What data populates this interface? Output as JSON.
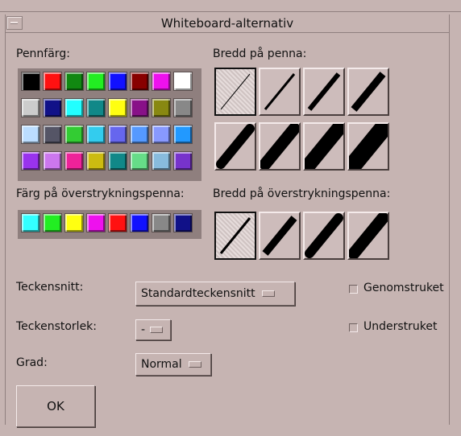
{
  "window": {
    "title": "Whiteboard-alternativ"
  },
  "pen_color": {
    "label": "Pennfärg:",
    "colors": [
      "#000000",
      "#ff1111",
      "#118811",
      "#22ee22",
      "#1111ff",
      "#880000",
      "#ee11ee",
      "#ffffff",
      "#cccccc",
      "#111188",
      "#22ffff",
      "#118888",
      "#ffff11",
      "#881188",
      "#888811",
      "#888888",
      "#bbddff",
      "#555566",
      "#33cc33",
      "#33ccee",
      "#6666ee",
      "#5599ff",
      "#8899ff",
      "#2299ff",
      "#9933ee",
      "#cc77ee",
      "#ee2299",
      "#ccbb11",
      "#118888",
      "#66dd88",
      "#88bbdd",
      "#7733cc"
    ]
  },
  "pen_width": {
    "label": "Bredd på penna:",
    "widths": [
      1,
      3,
      6,
      9,
      12,
      15,
      18,
      22
    ],
    "selected_index": 0
  },
  "highlighter_color": {
    "label": "Färg på överstrykningspenna:",
    "colors": [
      "#33ffff",
      "#22ee22",
      "#ffff11",
      "#ee11ee",
      "#ff1111",
      "#1111ff",
      "#888888",
      "#111188"
    ]
  },
  "highlighter_width": {
    "label": "Bredd på överstrykningspenna:",
    "widths": [
      3,
      9,
      12,
      15
    ],
    "selected_index": 0
  },
  "font": {
    "label": "Teckensnitt:",
    "value": "Standardteckensnitt"
  },
  "font_size": {
    "label": "Teckenstorlek:",
    "value": "-"
  },
  "degree": {
    "label": "Grad:",
    "value": "Normal"
  },
  "strikethrough": {
    "label": "Genomstruket",
    "checked": false
  },
  "underline": {
    "label": "Understruket",
    "checked": false
  },
  "ok": {
    "label": "OK"
  }
}
